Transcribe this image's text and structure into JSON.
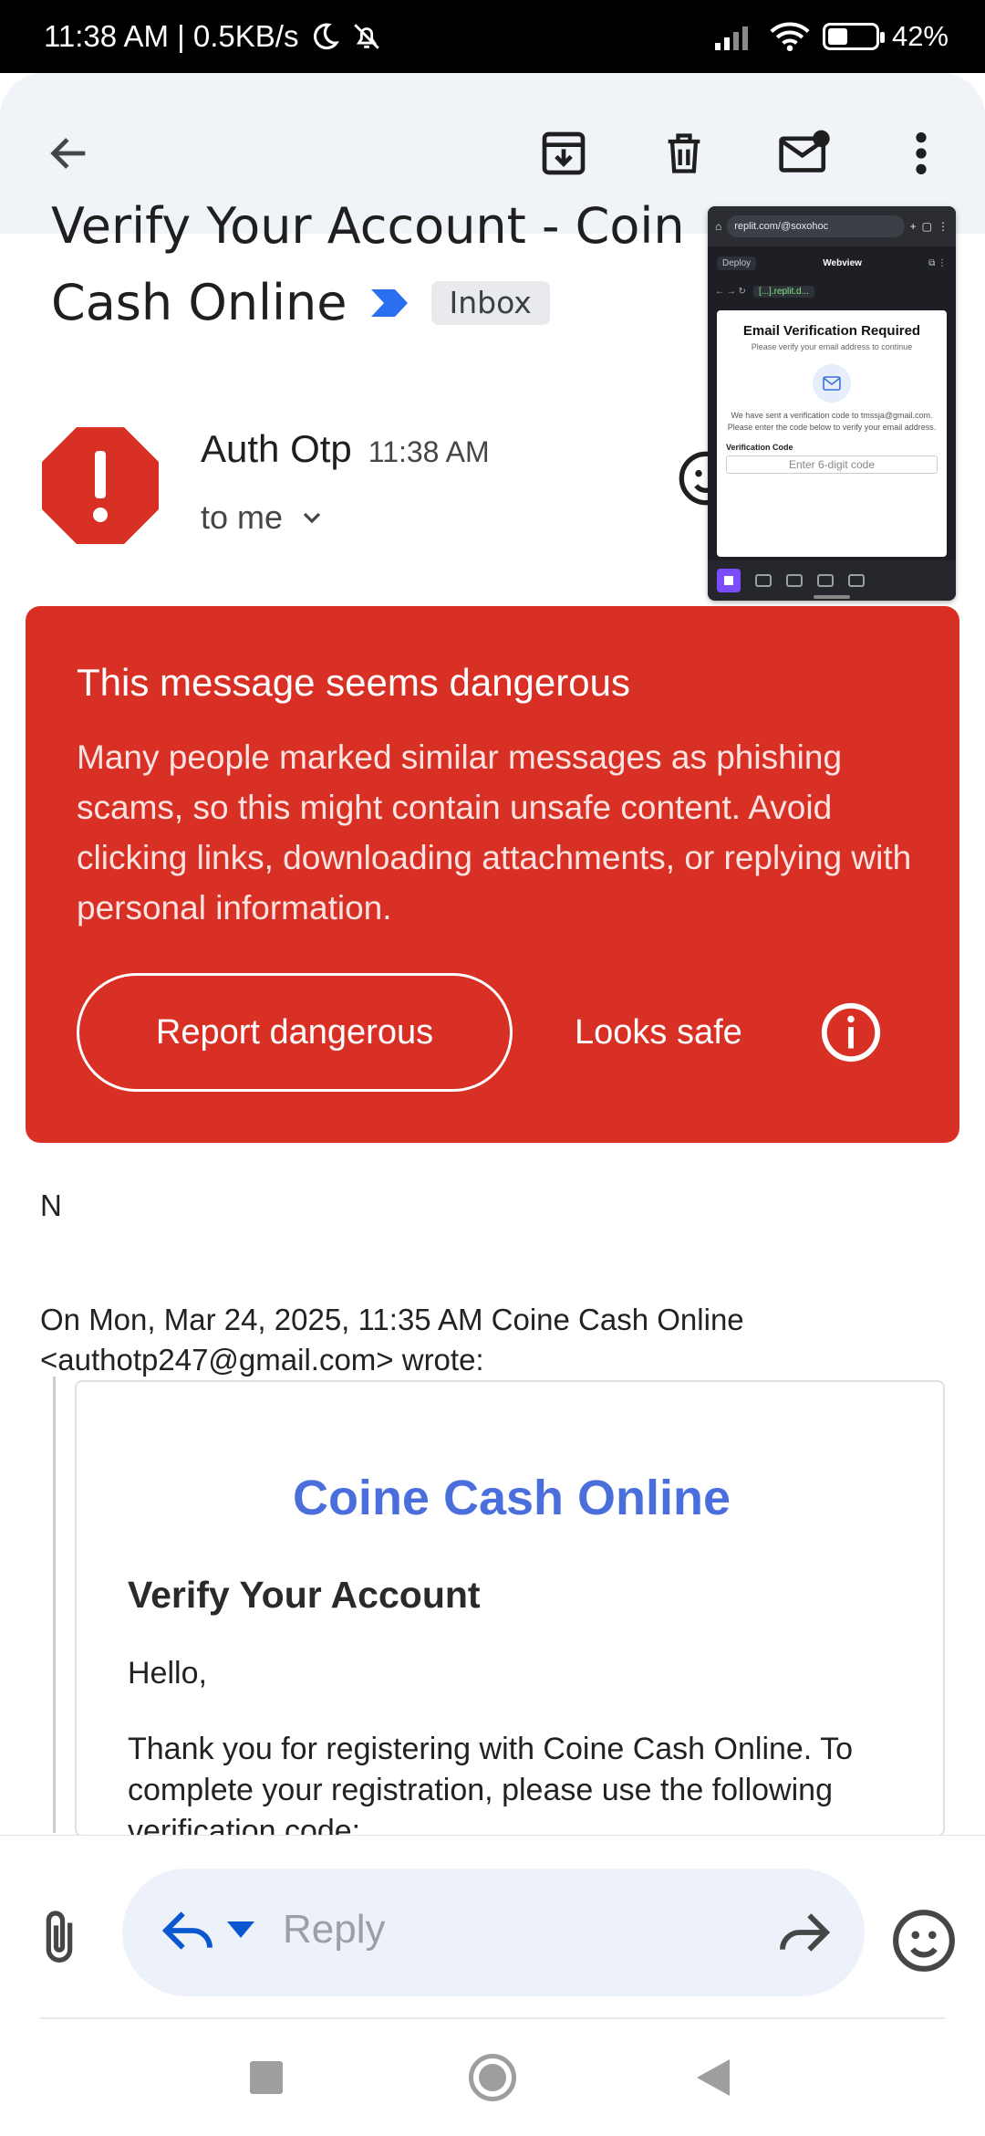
{
  "status_bar": {
    "time_speed": "11:38 AM | 0.5KB/s",
    "battery_percent": "42%",
    "battery_level": 0.42
  },
  "app_bar": {
    "icons": [
      "back-arrow-icon",
      "archive-icon",
      "delete-icon",
      "mark-unread-icon",
      "more-vert-icon"
    ]
  },
  "email": {
    "subject_line1": "Verify Your Account - Coin",
    "subject_line2": "Cash Online",
    "label": "Inbox",
    "sender": "Auth Otp",
    "time": "11:38 AM",
    "recipients": "to me"
  },
  "pip_window": {
    "url": "replit.com/@soxohoc",
    "deploy": "Deploy",
    "webview": "Webview",
    "address": "[...].replit.d...",
    "title": "Email Verification Required",
    "subtitle": "Please verify your email address to continue",
    "body": "We have sent a verification code to tmssja@gmail.com. Please enter the code below to verify your email address.",
    "code_label": "Verification Code",
    "code_placeholder": "Enter 6-digit code"
  },
  "warning": {
    "title": "This message seems dangerous",
    "text": "Many people marked similar messages as phishing scams, so this might contain unsafe content. Avoid clicking links, downloading attachments, or replying with personal information.",
    "report_label": "Report dangerous",
    "safe_label": "Looks safe",
    "color": "#d93025"
  },
  "body": {
    "text": "N",
    "quote_header": "On Mon, Mar 24, 2025, 11:35 AM Coine Cash Online <authotp247@gmail.com> wrote:",
    "brand": "Coine Cash Online",
    "brand_color": "#4a6fdc",
    "verify_title": "Verify Your Account",
    "hello": "Hello,",
    "thanks": "Thank you for registering with Coine Cash Online. To complete your registration, please use the following verification code:"
  },
  "reply_bar": {
    "placeholder": "Reply"
  }
}
